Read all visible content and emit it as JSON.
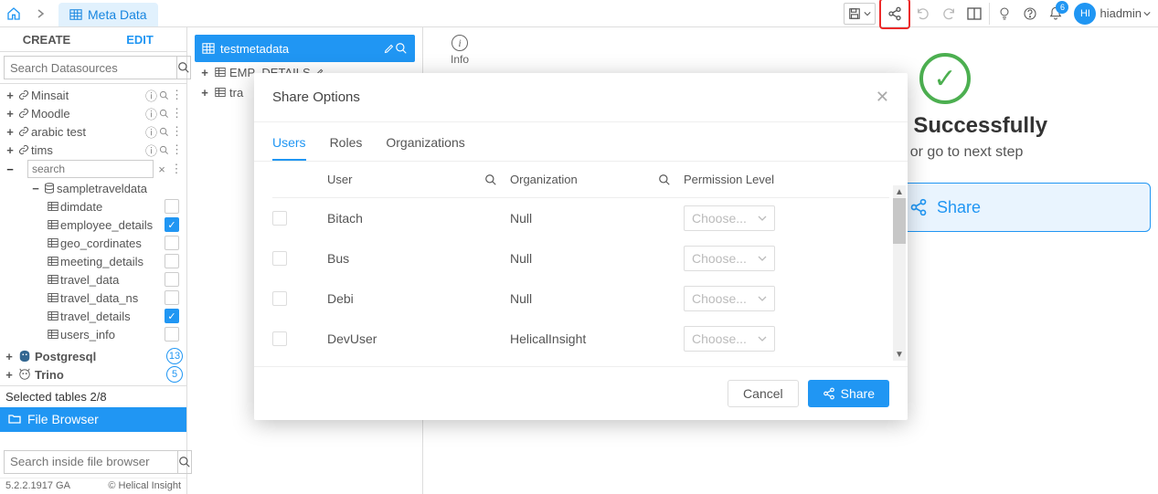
{
  "header": {
    "meta_tab_label": "Meta Data",
    "notifications_count": "6",
    "avatar_initials": "HI",
    "username": "hiadmin"
  },
  "left": {
    "tab_create": "CREATE",
    "tab_edit": "EDIT",
    "search_placeholder": "Search Datasources",
    "datasources": [
      {
        "name": "Minsait"
      },
      {
        "name": "Moodle"
      },
      {
        "name": "arabic test"
      },
      {
        "name": "tims"
      }
    ],
    "inline_search_placeholder": "search",
    "db_tree": {
      "database": "sampletraveldata",
      "tables": [
        {
          "name": "dimdate",
          "checked": false
        },
        {
          "name": "employee_details",
          "checked": true
        },
        {
          "name": "geo_cordinates",
          "checked": false
        },
        {
          "name": "meeting_details",
          "checked": false
        },
        {
          "name": "travel_data",
          "checked": false
        },
        {
          "name": "travel_data_ns",
          "checked": false
        },
        {
          "name": "travel_details",
          "checked": true
        },
        {
          "name": "users_info",
          "checked": false
        }
      ]
    },
    "pg_label": "Postgresql",
    "pg_count": "13",
    "trino_label": "Trino",
    "trino_count": "5",
    "selected_tables": "Selected tables 2/8",
    "file_browser": "File Browser",
    "file_search_placeholder": "Search inside file browser"
  },
  "footer": {
    "version": "5.2.2.1917 GA",
    "copyright": "© Helical Insight"
  },
  "mid": {
    "metadata_name": "testmetadata",
    "sub_items": [
      {
        "name": "EMP_DETAILS",
        "edit": true
      },
      {
        "name": "tra",
        "edit": false
      }
    ]
  },
  "right": {
    "info_label": "Info",
    "success_title_full": "Saved Successfully",
    "success_sub_full": "Share or go to next step",
    "share_btn": "Share"
  },
  "modal": {
    "title": "Share Options",
    "tabs": {
      "users": "Users",
      "roles": "Roles",
      "orgs": "Organizations"
    },
    "columns": {
      "user": "User",
      "org": "Organization",
      "perm": "Permission Level"
    },
    "perm_placeholder": "Choose...",
    "rows": [
      {
        "user": "Bitach",
        "org": "Null"
      },
      {
        "user": "Bus",
        "org": "Null"
      },
      {
        "user": "Debi",
        "org": "Null"
      },
      {
        "user": "DevUser",
        "org": "HelicalInsight"
      }
    ],
    "cancel": "Cancel",
    "share": "Share"
  }
}
